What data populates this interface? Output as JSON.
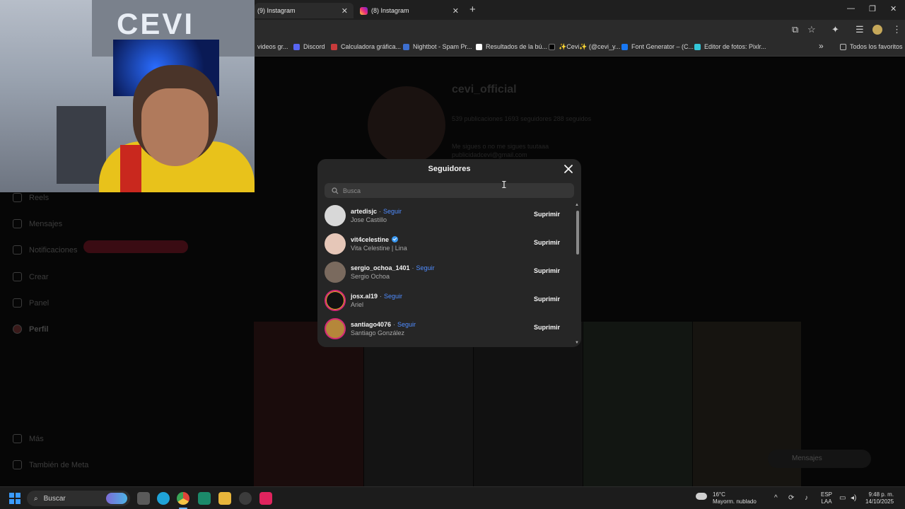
{
  "browser": {
    "tabs": [
      {
        "label": "(9) Instagram"
      },
      {
        "label": "(8) Instagram"
      }
    ],
    "new_tab": "+",
    "bookmarks": [
      {
        "label": "videos gr...",
        "color": "#5c5c5c"
      },
      {
        "label": "Discord",
        "color": "#5865f2"
      },
      {
        "label": "Calculadora gráfica...",
        "color": "#c83b3b"
      },
      {
        "label": "Nightbot - Spam Pr...",
        "color": "#3d6fd0"
      },
      {
        "label": "Resultados de la bú...",
        "color": "#ffffff"
      },
      {
        "label": "✨Cevi✨ (@cevi_y...",
        "color": "#000000"
      },
      {
        "label": "Font Generator – (C...",
        "color": "#1877f2"
      },
      {
        "label": "Editor de fotos: Pixlr...",
        "color": "#33c6d8"
      }
    ],
    "bookmarks_more": "»",
    "all_favorites": "Todos los favoritos"
  },
  "background_profile": {
    "username": "cevi_official",
    "stats_line": "539 publicaciones   1693 seguidores   288 seguidos",
    "bio_line_1": "Me sigues o no me sigues tuutaaa",
    "bio_line_2": "publicidadcevi@gmail.com",
    "sidebar": [
      {
        "label": "Reels"
      },
      {
        "label": "Mensajes"
      },
      {
        "label": "Notificaciones"
      },
      {
        "label": "Crear"
      },
      {
        "label": "Panel"
      },
      {
        "label": "Perfil"
      },
      {
        "label": "Más"
      },
      {
        "label": "También de Meta"
      }
    ],
    "messages_pill": "Mensajes"
  },
  "modal": {
    "title": "Seguidores",
    "search_placeholder": "Busca",
    "followers": [
      {
        "username": "artedisjc",
        "name": "Jose Castillo",
        "follow": "Seguir",
        "verified": false,
        "avatar_color": "#d8d8d8"
      },
      {
        "username": "vit4celestine",
        "name": "Vita Celestine | Lina",
        "follow": "",
        "verified": true,
        "avatar_color": "#e6c7b8"
      },
      {
        "username": "sergio_ochoa_1401",
        "name": "Sergio Ochoa",
        "follow": "Seguir",
        "verified": false,
        "avatar_color": "#7a6a5e"
      },
      {
        "username": "josx.al19",
        "name": "Ariel",
        "follow": "Seguir",
        "verified": false,
        "avatar_color": "#121212"
      },
      {
        "username": "santiago4076",
        "name": "Santiago González",
        "follow": "Seguir",
        "verified": false,
        "avatar_color": "#b5873a"
      }
    ],
    "remove_label": "Suprimir",
    "separator": "·"
  },
  "taskbar": {
    "search_label": "Buscar",
    "weather_temp": "16°C",
    "weather_desc": "Mayorm. nublado",
    "lang_1": "ESP",
    "lang_2": "LAA",
    "time": "9:48 p. m.",
    "date": "14/10/2025"
  }
}
